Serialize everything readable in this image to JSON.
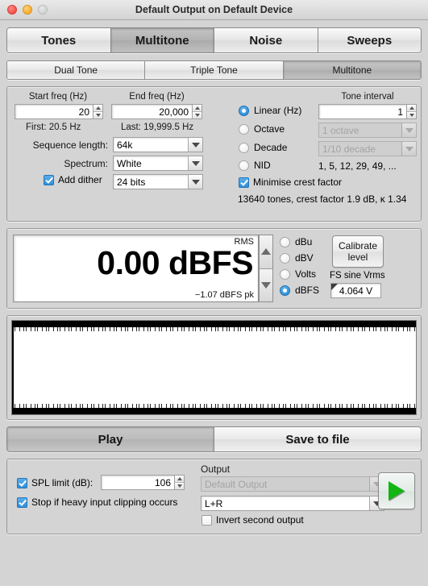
{
  "window": {
    "title": "Default Output on Default Device",
    "traffic_lights": [
      "close-red",
      "minimise-yellow",
      "zoom-disabled"
    ]
  },
  "main_tabs": [
    {
      "label": "Tones",
      "active": false
    },
    {
      "label": "Multitone",
      "active": true
    },
    {
      "label": "Noise",
      "active": false
    },
    {
      "label": "Sweeps",
      "active": false
    }
  ],
  "sub_tabs": [
    {
      "label": "Dual Tone",
      "active": false
    },
    {
      "label": "Triple Tone",
      "active": false
    },
    {
      "label": "Multitone",
      "active": true
    }
  ],
  "settings": {
    "start_freq_label": "Start freq (Hz)",
    "start_freq_value": "20",
    "end_freq_label": "End freq (Hz)",
    "end_freq_value": "20,000",
    "first_info": "First: 20.5 Hz",
    "last_info": "Last: 19,999.5 Hz",
    "sequence_length_label": "Sequence length:",
    "sequence_length_value": "64k",
    "spectrum_label": "Spectrum:",
    "spectrum_value": "White",
    "add_dither_label": "Add dither",
    "add_dither_checked": true,
    "dither_bits_value": "24 bits",
    "tone_interval_label": "Tone interval",
    "tone_interval_value": "1",
    "spacing_options": [
      {
        "label": "Linear (Hz)",
        "selected": true
      },
      {
        "label": "Octave",
        "selected": false
      },
      {
        "label": "Decade",
        "selected": false
      },
      {
        "label": "NID",
        "selected": false
      }
    ],
    "octave_value": "1 octave",
    "decade_value": "1/10 decade",
    "nid_series": "1, 5, 12, 29, 49, ...",
    "minimise_crest_label": "Minimise crest factor",
    "minimise_crest_checked": true,
    "tone_summary": "13640 tones, crest factor 1.9 dB, κ 1.34"
  },
  "meter": {
    "rms_label": "RMS",
    "level_value": "0.00 dBFS",
    "peak_value": "−1.07 dBFS pk",
    "units": [
      {
        "label": "dBu",
        "selected": false
      },
      {
        "label": "dBV",
        "selected": false
      },
      {
        "label": "Volts",
        "selected": false
      },
      {
        "label": "dBFS",
        "selected": true
      }
    ],
    "calibrate_line1": "Calibrate",
    "calibrate_line2": "level",
    "fs_sine_label": "FS sine Vrms",
    "fs_sine_value": "4.064 V"
  },
  "transport": [
    {
      "label": "Play",
      "active": true
    },
    {
      "label": "Save to file",
      "active": false
    }
  ],
  "bottom": {
    "spl_limit_label": "SPL limit (dB):",
    "spl_limit_checked": true,
    "spl_limit_value": "106",
    "stop_clipping_label": "Stop if heavy input clipping occurs",
    "stop_clipping_checked": true,
    "output_group_label": "Output",
    "output_device_value": "Default Output",
    "output_device_disabled": true,
    "output_channel_value": "L+R",
    "invert_label": "Invert second output",
    "invert_checked": false,
    "play_icon": "play-triangle-green"
  },
  "colors": {
    "accent_blue": "#2f8fdd",
    "play_green": "#13b513",
    "window_bg": "#d4d4d4"
  }
}
